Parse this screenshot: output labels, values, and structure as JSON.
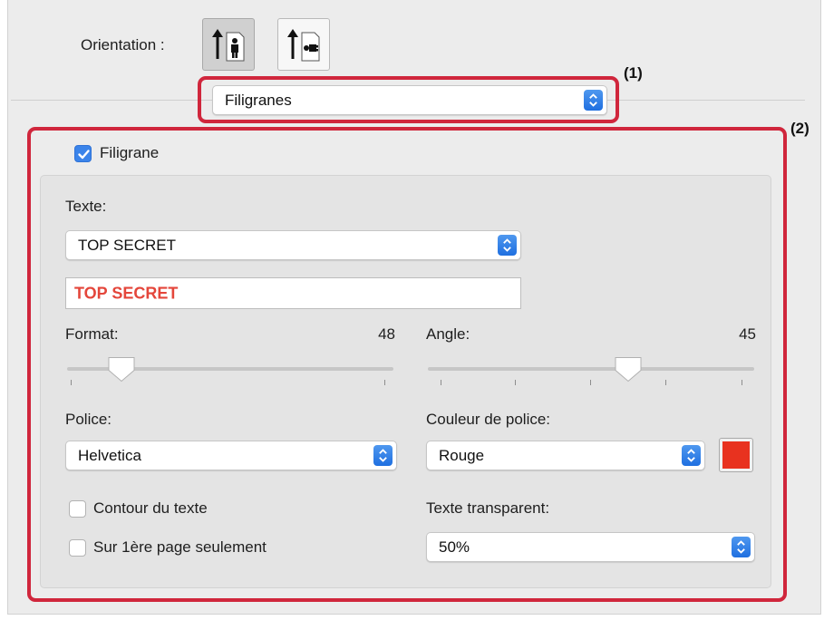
{
  "orientation": {
    "label": "Orientation :",
    "options": [
      "portrait-orientation-icon",
      "landscape-orientation-icon"
    ],
    "selected": "portrait-orientation-icon"
  },
  "panel_menu": {
    "value": "Filigranes"
  },
  "callouts": {
    "one": "(1)",
    "two": "(2)"
  },
  "watermark": {
    "enabled_label": "Filigrane",
    "enabled": true,
    "text_label": "Texte:",
    "text_preset": "TOP SECRET",
    "text_value": "TOP SECRET",
    "size_label": "Format:",
    "size_value": "48",
    "angle_label": "Angle:",
    "angle_value": "45",
    "font_label": "Police:",
    "font_value": "Helvetica",
    "color_label": "Couleur de police:",
    "color_value": "Rouge",
    "color_hex": "#e8321f",
    "outline_label": "Contour du texte",
    "outline_checked": false,
    "first_page_label": "Sur 1ère page seulement",
    "first_page_checked": false,
    "transparency_label": "Texte transparent:",
    "transparency_value": "50%"
  },
  "colors": {
    "accent": "#2f7be8",
    "highlight_border": "#d0263c",
    "watermark_text": "#e4463b"
  }
}
